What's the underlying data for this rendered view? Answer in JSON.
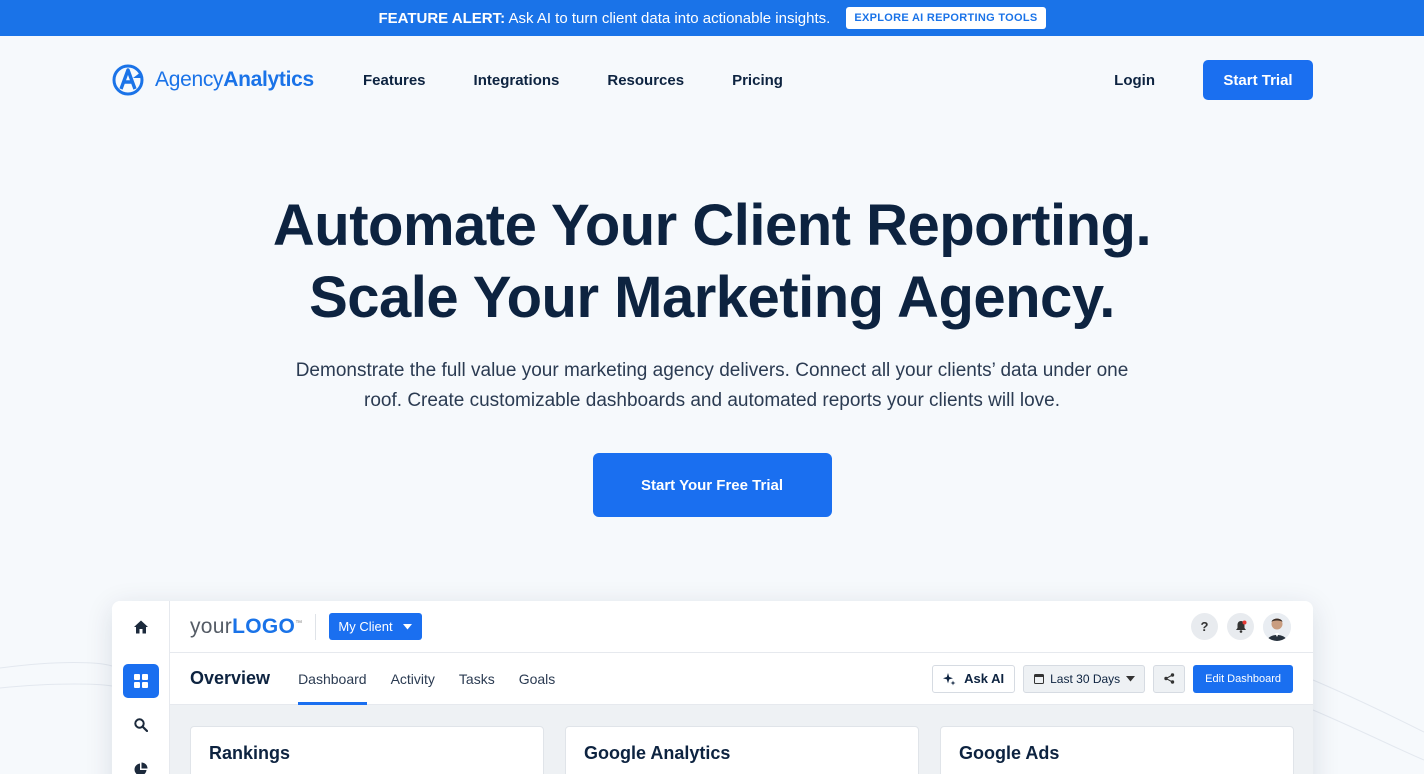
{
  "alert": {
    "prefix": "FEATURE ALERT:",
    "text": "Ask AI to turn client data into actionable insights.",
    "button": "EXPLORE AI REPORTING TOOLS"
  },
  "nav": {
    "logo_light": "Agency",
    "logo_bold": "Analytics",
    "links": [
      "Features",
      "Integrations",
      "Resources",
      "Pricing"
    ],
    "login": "Login",
    "start_trial": "Start Trial"
  },
  "hero": {
    "title_line1": "Automate Your Client Reporting.",
    "title_line2": "Scale Your Marketing Agency.",
    "subtitle": "Demonstrate the full value your marketing agency delivers. Connect all your clients’ data under one roof. Create customizable dashboards and automated reports your clients will love.",
    "cta": "Start Your Free Trial"
  },
  "dashboard": {
    "logo_your": "your",
    "logo_logo": "LOGO",
    "logo_tm": "™",
    "client": "My Client",
    "help": "?",
    "title": "Overview",
    "tabs": [
      "Dashboard",
      "Activity",
      "Tasks",
      "Goals"
    ],
    "active_tab": "Dashboard",
    "ask_ai": "Ask AI",
    "date_range": "Last 30 Days",
    "edit": "Edit Dashboard",
    "cards": [
      "Rankings",
      "Google Analytics",
      "Google Ads"
    ]
  },
  "colors": {
    "brand_blue": "#1a6ff0",
    "navy": "#0d2340",
    "background": "#f6f9fc"
  }
}
